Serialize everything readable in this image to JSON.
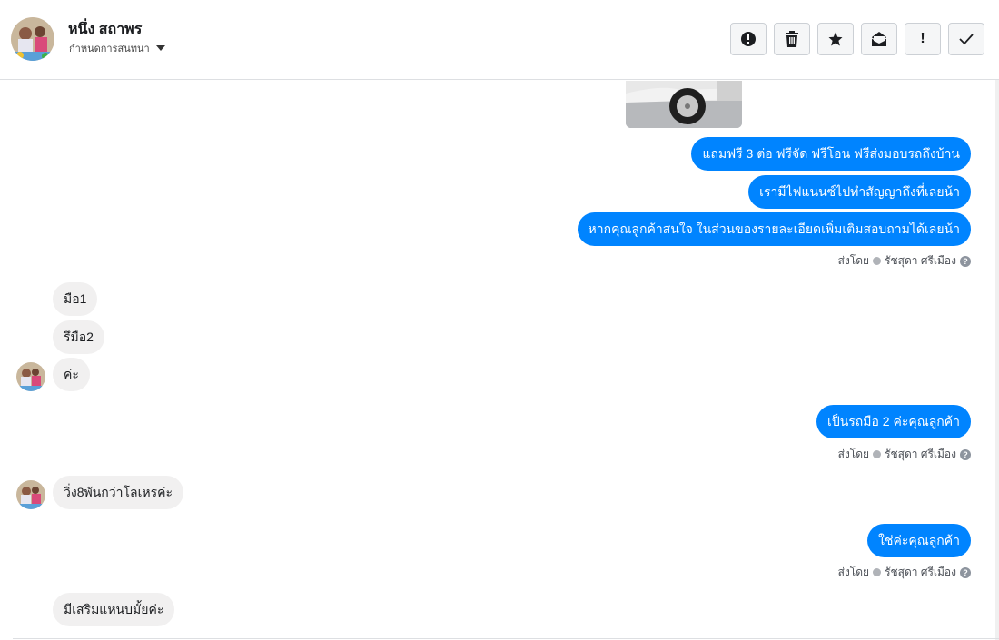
{
  "header": {
    "contact_name": "หนึ่ง สถาพร",
    "assign_label": "กำหนดการสนทนา",
    "avatar_icon": "avatar-photo"
  },
  "toolbar": {
    "buttons": [
      {
        "name": "report-spam-button",
        "icon": "alert-circle-icon"
      },
      {
        "name": "delete-button",
        "icon": "trash-icon"
      },
      {
        "name": "star-button",
        "icon": "star-icon"
      },
      {
        "name": "mark-unread-button",
        "icon": "envelope-open-icon"
      },
      {
        "name": "important-button",
        "icon": "exclamation-icon",
        "label": "!"
      },
      {
        "name": "mark-done-button",
        "icon": "check-icon"
      }
    ]
  },
  "colors": {
    "outgoing_bubble": "#0084ff",
    "incoming_bubble": "#f1f0f0",
    "border": "#dddfe2"
  },
  "messages": {
    "out_1": "แถมฟรี 3 ต่อ ฟรีจัด ฟรีโอน  ฟรีส่งมอบรถถึงบ้าน",
    "out_2": "เรามีไฟแนนซ์ไปทำสัญญาถึงที่เลยน้า",
    "out_3": "หากคุณลูกค้าสนใจ ในส่วนของรายละเอียดเพิ่มเติมสอบถามได้เลยน้า",
    "in_1": "มือ1",
    "in_2": "รึมือ2",
    "in_3": "ค่ะ",
    "out_4": "เป็นรถมือ 2 ค่ะคุณลูกค้า",
    "in_4": "วิ่ง8พันกว่าโลเหรค่ะ",
    "out_5": "ใช่ค่ะคุณลูกค้า",
    "in_5": "มีเสริมแหนบมั้ยค่ะ"
  },
  "sent_by": {
    "prefix": "ส่งโดย",
    "agent": "รัชสุดา ศรีเมือง",
    "help": "?"
  }
}
